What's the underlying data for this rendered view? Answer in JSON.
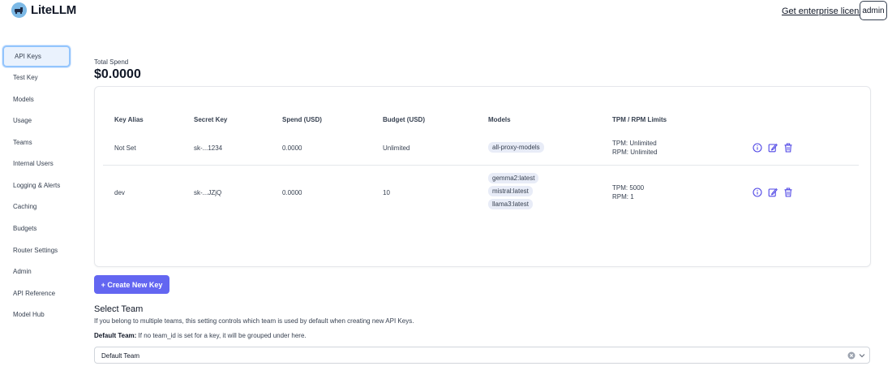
{
  "header": {
    "app_name": "LiteLLM",
    "enterprise_link": "Get enterprise license",
    "user_button": "admin"
  },
  "sidebar": {
    "items": [
      {
        "label": "API Keys",
        "active": true
      },
      {
        "label": "Test Key"
      },
      {
        "label": "Models"
      },
      {
        "label": "Usage"
      },
      {
        "label": "Teams"
      },
      {
        "label": "Internal Users"
      },
      {
        "label": "Logging & Alerts"
      },
      {
        "label": "Caching"
      },
      {
        "label": "Budgets"
      },
      {
        "label": "Router Settings"
      },
      {
        "label": "Admin"
      },
      {
        "label": "API Reference"
      },
      {
        "label": "Model Hub"
      }
    ]
  },
  "spend": {
    "label": "Total Spend",
    "value": "$0.0000"
  },
  "table": {
    "columns": [
      "Key Alias",
      "Secret Key",
      "Spend (USD)",
      "Budget (USD)",
      "Models",
      "TPM / RPM Limits"
    ],
    "rows": [
      {
        "key_alias": "Not Set",
        "secret_key": "sk-...1234",
        "spend": "0.0000",
        "budget": "Unlimited",
        "models": [
          "all-proxy-models"
        ],
        "tpm": "TPM: Unlimited",
        "rpm": "RPM: Unlimited"
      },
      {
        "key_alias": "dev",
        "secret_key": "sk-...JZjQ",
        "spend": "0.0000",
        "budget": "10",
        "models": [
          "gemma2:latest",
          "mistral:latest",
          "llama3:latest"
        ],
        "tpm": "TPM: 5000",
        "rpm": "RPM: 1"
      }
    ]
  },
  "create_button": "+ Create New Key",
  "team_section": {
    "title": "Select Team",
    "description": "If you belong to multiple teams, this setting controls which team is used by default when creating new API Keys.",
    "default_label": "Default Team:",
    "default_text": " If no team_id is set for a key, it will be grouped under here.",
    "selected_value": "Default Team"
  },
  "colors": {
    "accent": "#6366f1",
    "icon": "#4f46e5",
    "active_border": "#93c5fd"
  }
}
